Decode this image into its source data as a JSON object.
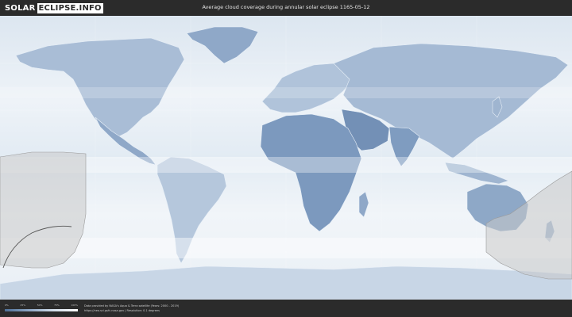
{
  "header": {
    "logo_part1": "SOLAR",
    "logo_part2": "ECLIPSE.INFO",
    "title": "Average cloud coverage during annular solar eclipse 1165-05-12"
  },
  "legend": {
    "ticks": [
      "0%",
      "25%",
      "50%",
      "75%",
      "100%"
    ],
    "colors": [
      "#4d6f96",
      "#8ea8c6",
      "#d4e0ec",
      "#ffffff"
    ]
  },
  "footer": {
    "credit_line1": "Data provided by NASA's Aqua & Terra satellite (Years: 2000 - 2019)",
    "credit_line2": "https://neo.sci.gsfc.nasa.gov | Resolution: 0.1 degrees"
  },
  "map": {
    "ocean_color": "#e8eff6",
    "land_color": "#7f9cc0",
    "eclipse_shadow_color": "#c8c8c8"
  }
}
